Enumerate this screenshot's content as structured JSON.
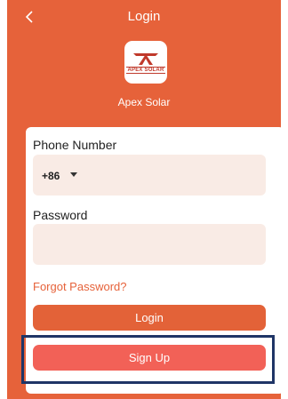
{
  "header": {
    "back_icon": "chevron-left-icon",
    "title": "Login"
  },
  "brand": {
    "logo_text": "APEX SOLAR",
    "name": "Apex Solar"
  },
  "form": {
    "phone_label": "Phone Number",
    "country_code": "+86",
    "password_label": "Password",
    "password_value": "",
    "forgot_link": "Forgot Password?",
    "login_button": "Login",
    "signup_button": "Sign Up"
  },
  "colors": {
    "background": "#e6623a",
    "field": "#f9ebe5",
    "login_button": "#e36238",
    "signup_button": "#f26157",
    "highlight": "#1f3566"
  }
}
